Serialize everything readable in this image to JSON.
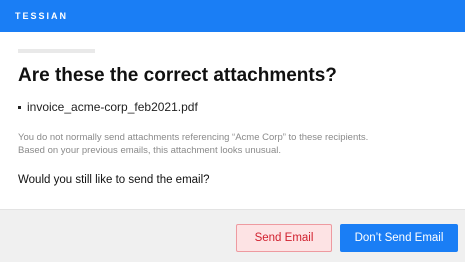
{
  "header": {
    "brand": "TESSIAN"
  },
  "dialog": {
    "title": "Are these the correct attachments?",
    "attachments": [
      "invoice_acme-corp_feb2021.pdf"
    ],
    "info_line1": "You do not normally send attachments referencing “Acme Corp” to these recipients.",
    "info_line2": "Based on your previous emails, this attachment looks unusual.",
    "question": "Would you still like to send the email?"
  },
  "footer": {
    "send_label": "Send Email",
    "dont_send_label": "Don’t Send Email"
  },
  "colors": {
    "brand_blue": "#1a7ef5",
    "danger_text": "#d1202e",
    "danger_bg": "#fde3e4",
    "footer_bg": "#f0f0f0"
  }
}
